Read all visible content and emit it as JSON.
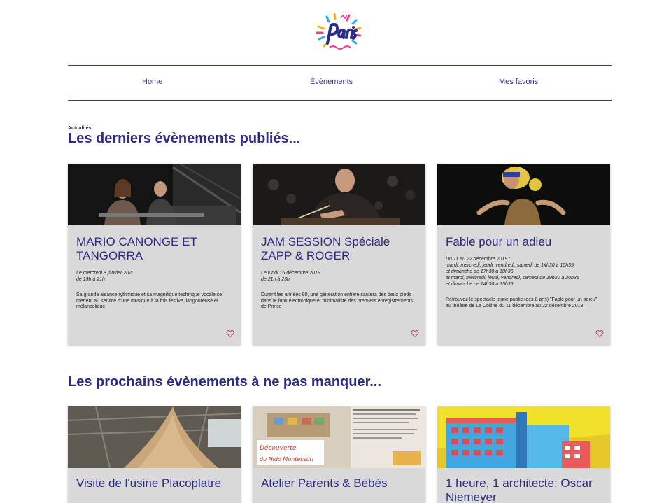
{
  "nav": {
    "home": "Home",
    "events": "Évènements",
    "favorites": "Mes favoris"
  },
  "kicker": "Actualités",
  "sections": {
    "latest_title": "Les derniers évènements publiés...",
    "upcoming_title": "Les prochains évènements à ne pas manquer..."
  },
  "latest_cards": [
    {
      "title": "MARIO CANONGE ET TANGORRA",
      "date_line1": "Le mercredi 8 janvier 2020",
      "date_line2": "de 19h à 21h",
      "desc": "Sa grande aisance rythmique et sa magnifique technique vocale se mettent au service d'une musique à la fois festive, langoureuse et mélancolique."
    },
    {
      "title": "JAM SESSION Spéciale ZAPP & ROGER",
      "date_line1": "Le lundi 16 décembre 2019",
      "date_line2": "de 21h à 23h",
      "desc": "Durant les années 80, une génération entière sautera des deux pieds dans le funk électronique et minimaliste des premiers enregistrements de Prince"
    },
    {
      "title": "Fable pour un adieu",
      "date_line1": "Du 11 au 22 décembre 2019 :",
      "date_line2": "mardi, mercredi, jeudi, vendredi, samedi de 14h30 à 15h35",
      "date_line3": "et dimanche de 17h30 à 18h35",
      "date_line4": "et mardi, mercredi, jeudi, vendredi, samedi de 19h30 à 20h35",
      "date_line5": "et dimanche de 14h30 à 15h35",
      "desc": "Retrouvez le spectacle jeune public (dès 8 ans) \"Fable pour un adieu\" au théâtre de La Colline du 11 décembre au 22 décembre 2019."
    }
  ],
  "upcoming_cards": [
    {
      "title": "Visite de l'usine Placoplatre"
    },
    {
      "title": "Atelier Parents & Bébés",
      "image_caption_1": "Découverte",
      "image_caption_2": "du Nido Montessori"
    },
    {
      "title": "1 heure, 1 architecte: Oscar Niemeyer"
    }
  ],
  "colors": {
    "accent": "#2e2a86",
    "card_bg": "#d9d9d9",
    "heart": "#c0406a",
    "nav_border": "#3a3580"
  },
  "icons": {
    "logo": "paris-logo",
    "favorite": "heart-outline-icon"
  }
}
